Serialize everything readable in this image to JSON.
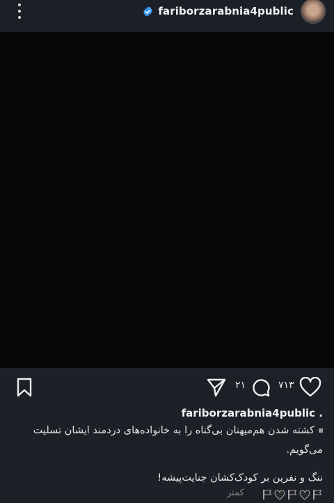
{
  "header": {
    "username": "fariborzarabnia4public",
    "verified_icon": "verified-badge-icon",
    "menu_icon": "more-vertical-icon"
  },
  "actions": {
    "like_count": "۷۱۳",
    "comment_count": "۲۱",
    "icons": [
      "heart-icon",
      "comment-icon",
      "share-icon",
      "save-icon"
    ]
  },
  "caption": {
    "username": "fariborzarabnia4public .",
    "line1": "کشته شدن هم‌میهنان بی‌گناه را به خانواده‌های دردمند ایشان تسلیت می‌گویم.",
    "line2": "ننگ و نفرین بر کودک‌کشان جنایت‌پیشه!",
    "less_label": "کمتر",
    "emoji": [
      "black-flag",
      "black-heart",
      "black-flag",
      "black-heart",
      "black-flag"
    ]
  },
  "colors": {
    "background": "#1c2027",
    "media": "#080808",
    "verified": "#3897f0"
  }
}
